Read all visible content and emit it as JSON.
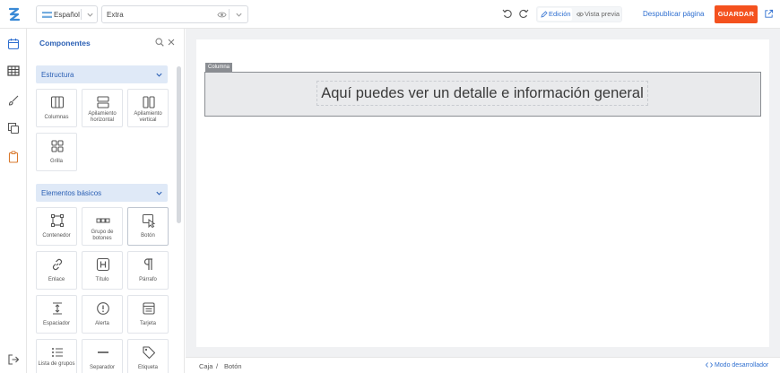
{
  "header": {
    "language": "Español",
    "page_select": "Extra",
    "mode_edit": "Edición",
    "mode_preview": "Vista previa",
    "unpublish": "Despublicar página",
    "save": "GUARDAR"
  },
  "panel": {
    "title": "Componentes",
    "sections": [
      {
        "label": "Estructura",
        "items": [
          "Columnas",
          "Apilamiento horizontal",
          "Apilamiento vertical",
          "Grilla"
        ]
      },
      {
        "label": "Elementos básicos",
        "items": [
          "Contenedor",
          "Grupo de botones",
          "Botón",
          "Enlace",
          "Título",
          "Párrafo",
          "Espaciador",
          "Alerta",
          "Tarjeta",
          "Lista de grupos",
          "Separador",
          "Etiqueta"
        ]
      }
    ]
  },
  "canvas": {
    "column_tag": "Columna",
    "heading": "Aquí puedes ver un detalle e información general"
  },
  "breadcrumb": [
    "Caja",
    "/",
    "Botón"
  ],
  "dev_mode": "Modo desarrollador",
  "colors": {
    "accent": "#2f6fd0",
    "save_button": "#f4511e",
    "section_bg": "#dfe9f7"
  }
}
